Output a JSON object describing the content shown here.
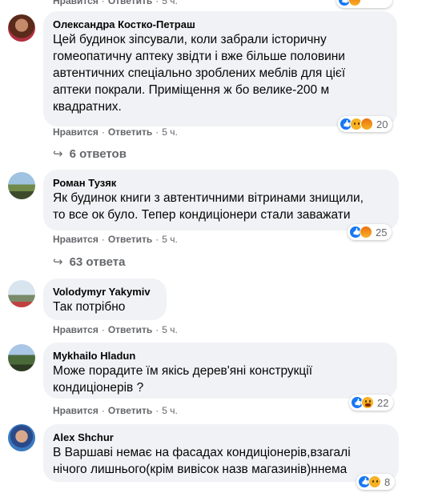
{
  "actions": {
    "like": "Нравится",
    "reply": "Ответить",
    "sep": "·"
  },
  "comments": [
    {
      "author": "Олександра Костко-Петраш",
      "lines": [
        "Цей будинок зіпсували, коли забрали історичну",
        "гомеопатичну аптеку звідти і вже більше половини",
        "автентичних спеціально зроблених меблів для цієї",
        "аптеки покрали. Приміщення ж бо велике-200 м",
        "квадратних."
      ],
      "time": "5 ч.",
      "reaction_count": "20",
      "reactions": [
        "like",
        "sad",
        "angry"
      ],
      "replies": "6 ответов"
    },
    {
      "author": "Роман Тузяк",
      "lines": [
        "Як будинок книги з автентичними вітринами знищили,",
        "то все ок було. Тепер кондиціонери стали заважати"
      ],
      "time": "5 ч.",
      "reaction_count": "25",
      "reactions": [
        "like",
        "angry"
      ],
      "replies": "63 ответа"
    },
    {
      "author": "Volodymyr Yakymiv",
      "lines": [
        "Так потрібно"
      ],
      "time": "5 ч."
    },
    {
      "author": "Mykhailo Hladun",
      "lines": [
        "Може порадите їм якісь дерев'яні конструкції",
        "кондиціонерів ?"
      ],
      "time": "5 ч.",
      "reaction_count": "22",
      "reactions": [
        "like",
        "haha"
      ]
    },
    {
      "author": "Alex Shchur",
      "lines": [
        "В Варшаві немає на фасадах кондиціонерів,взагалі",
        "нічого лишнього(крім вивісок назв магазинів)ннема"
      ],
      "reaction_count": "8",
      "reactions": [
        "like",
        "sad"
      ]
    }
  ],
  "colors": {
    "bubble": "#f0f2f5",
    "meta": "#65676b",
    "like": "#1877f2",
    "emoji": "#f7b125"
  }
}
